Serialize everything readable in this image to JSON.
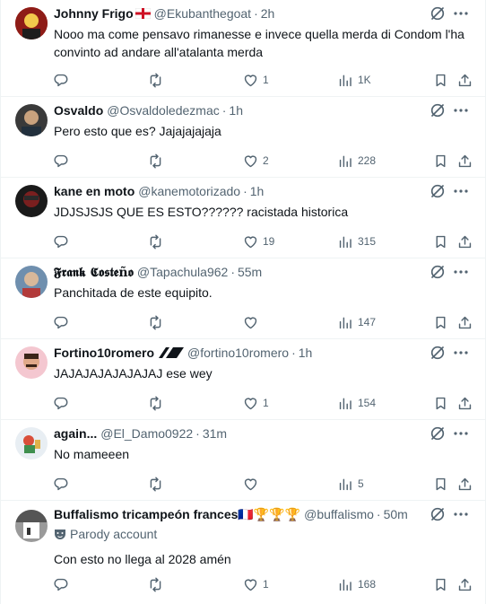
{
  "posts": [
    {
      "name": "Johnny Frigo",
      "flag": "england",
      "handle": "@Ekubanthegoat",
      "separator": "·",
      "time": "2h",
      "text": "Nooo ma come pensavo rimanesse e invece quella merda di Condom l'ha convinto ad andare all'atalanta merda",
      "likes": "1",
      "views": "1K",
      "avatar_colors": [
        "#b3261e",
        "#f2c94c"
      ]
    },
    {
      "name": "Osvaldo",
      "handle": "@Osvaldoledezmac",
      "separator": "·",
      "time": "1h",
      "text": "Pero esto que es? Jajajajajaja",
      "likes": "2",
      "views": "228",
      "avatar_colors": [
        "#2c2c2c",
        "#c9a27e"
      ]
    },
    {
      "name": "kane en moto",
      "handle": "@kanemotorizado",
      "separator": "·",
      "time": "1h",
      "text": "JDJSJSJS QUE ES ESTO?????? racistada historica",
      "likes": "19",
      "views": "315",
      "avatar_colors": [
        "#7a1f1f",
        "#1a1a1a"
      ]
    },
    {
      "name": "𝕱𝖗𝖆𝖓𝖐 𝕮𝖔𝖘𝖙𝖊ñ𝖔",
      "handle": "@Tapachula962",
      "separator": "·",
      "time": "55m",
      "text": "Panchitada de este equipito.",
      "likes": "",
      "views": "147",
      "avatar_colors": [
        "#4a6a8a",
        "#d8b89a"
      ]
    },
    {
      "name": "Fortino10romero",
      "handle": "@fortino10romero",
      "separator": "·",
      "time": "1h",
      "text": "JAJAJAJAJAJAJAJ ese wey",
      "likes": "1",
      "views": "154",
      "avatar_colors": [
        "#f4c7d0",
        "#6b3b2a"
      ]
    },
    {
      "name": "again...",
      "handle": "@El_Damo0922",
      "separator": "·",
      "time": "31m",
      "text": "No mameeen",
      "likes": "",
      "views": "5",
      "avatar_colors": [
        "#e8eef3",
        "#d94f3a"
      ]
    },
    {
      "name": "Buffalismo tricampeón frances🇫🇷🏆🏆🏆",
      "handle": "@buffalismo",
      "separator": "·",
      "time": "50m",
      "parody": "Parody account",
      "text": "Con esto no llega al 2028 amén",
      "likes": "1",
      "views": "168",
      "avatar_colors": [
        "#555555",
        "#dddddd"
      ]
    }
  ]
}
